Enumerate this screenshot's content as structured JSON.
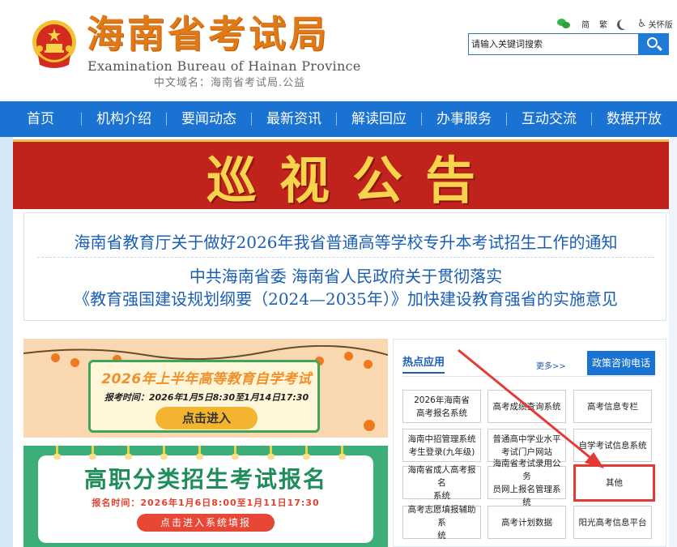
{
  "header": {
    "title": "海南省考试局",
    "subtitle": "Examination Bureau of Hainan Province",
    "domain": "中文域名：海南省考试局.公益",
    "tools": {
      "simplified": "简",
      "traditional": "繁",
      "accessibility": "关怀版"
    },
    "search": {
      "placeholder": "请输入关键词搜索"
    }
  },
  "nav": {
    "items": [
      "首页",
      "机构介绍",
      "要闻动态",
      "最新资讯",
      "解读回应",
      "办事服务",
      "互动交流",
      "数据开放"
    ]
  },
  "banner": {
    "text": "巡视公告"
  },
  "notices": {
    "line1": "海南省教育厅关于做好2026年我省普通高等学校专升本考试招生工作的通知",
    "line2": "中共海南省委 海南省人民政府关于贯彻落实",
    "line3": "《教育强国建设规划纲要（2024—2035年）》加快建设教育强省的实施意见"
  },
  "promo1": {
    "title": "2026年上半年高等教育自学考试",
    "time": "报考时间：2026年1月5日8:30至1月14日17:30",
    "button": "点击进入"
  },
  "promo2": {
    "title": "高职分类招生考试报名",
    "time": "报名时间：2026年1月6日8:00至1月11日17:30",
    "button": "点击进入系统填报"
  },
  "apps": {
    "title": "热点应用",
    "more": "更多>>",
    "hotline": "政策咨询电话",
    "items": [
      {
        "line1": "2026年海南省",
        "line2": "高考报名系统"
      },
      {
        "line1": "高考成绩查询系统",
        "line2": ""
      },
      {
        "line1": "高考信息专栏",
        "line2": ""
      },
      {
        "line1": "海南中招管理系统",
        "line2": "考生登录(九年级)"
      },
      {
        "line1": "普通高中学业水平",
        "line2": "考试门户网站"
      },
      {
        "line1": "自学考试信息系统",
        "line2": ""
      },
      {
        "line1": "海南省成人高考报名",
        "line2": "系统"
      },
      {
        "line1": "海南省考试录用公务",
        "line2": "员网上报名管理系统"
      },
      {
        "line1": "其他",
        "line2": ""
      },
      {
        "line1": "高考志愿填报辅助系",
        "line2": "统"
      },
      {
        "line1": "高考计划数据",
        "line2": ""
      },
      {
        "line1": "阳光高考信息平台",
        "line2": ""
      }
    ]
  },
  "colors": {
    "nav_blue": "#1a72d2",
    "title_orange": "#e07a18",
    "banner_red": "#c0231c",
    "banner_gold": "#f7d44c",
    "link_blue": "#1a5fb4",
    "highlight_red": "#e53935"
  },
  "icons": [
    "emblem-icon",
    "wechat-icon",
    "moon-icon",
    "accessibility-icon",
    "search-icon"
  ]
}
